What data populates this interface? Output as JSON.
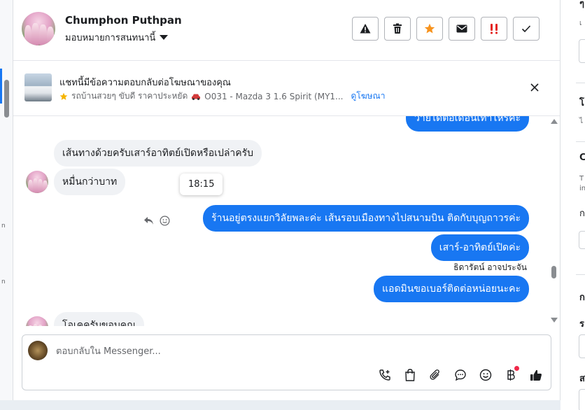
{
  "header": {
    "contact_name": "Chumphon Puthpan",
    "assign_label": "มอบหมายการสนทนานี้",
    "actions": [
      "warning-icon",
      "trash-icon",
      "star-icon",
      "envelope-icon",
      "important-icon",
      "check-icon"
    ],
    "colors": {
      "star": "#f7931e",
      "important": "#e4231f"
    }
  },
  "ad_banner": {
    "title": "แชทนี้มีข้อความตอบกลับต่อโฆษณาของคุณ",
    "subtitle": "รถบ้านสวยๆ ขับดี ราคาประหยัด",
    "ad_name": "O031 - Mazda 3 1.6 Spirit (MY1...",
    "link": "ดูโฆษณา"
  },
  "messages": [
    {
      "dir": "out",
      "text": "ว่ายได้ต่อเดือนเท่าไหร่คะ"
    },
    {
      "dir": "in",
      "text": "เส้นทางด้วยครับเสาร์อาทิตย์เปิดหรือเปล่าครับ"
    },
    {
      "dir": "in",
      "text": "หมื่นกว่าบาท"
    },
    {
      "dir": "out",
      "text": "ร้านอยู่ตรงแยกวิลัยพละค่ะ เส้นรอบเมืองทางไปสนามบิน ติดกับบุญถาวรค่ะ"
    },
    {
      "dir": "out",
      "text": "เสาร์-อาทิตย์เปิดค่ะ"
    },
    {
      "dir": "out",
      "text": "แอดมินขอเบอร์ติดต่อหน่อยนะคะ"
    },
    {
      "dir": "in",
      "text": "โอเคครับขอบคุณ"
    }
  ],
  "tooltip_time": "18:15",
  "sender_name": "ธิดารัตน์ อาจประจัน",
  "composer": {
    "placeholder": "ตอบกลับใน Messenger...",
    "tools": [
      "call-plus-icon",
      "bag-icon",
      "paperclip-icon",
      "chat-bubble-icon",
      "emoji-icon",
      "baht-icon",
      "thumbs-up-icon"
    ],
    "colors": {
      "thumbs_up": "#1c1e21",
      "badge": "#f02849"
    }
  },
  "right_panel": {
    "items": [
      "ๆ",
      "เ",
      "โ",
      "ไ",
      "C",
      "T",
      "in",
      "ก",
      "ก",
      "ร",
      "ส"
    ]
  },
  "colors": {
    "accent": "#1877f2",
    "incoming_bubble": "#f0f2f5"
  }
}
